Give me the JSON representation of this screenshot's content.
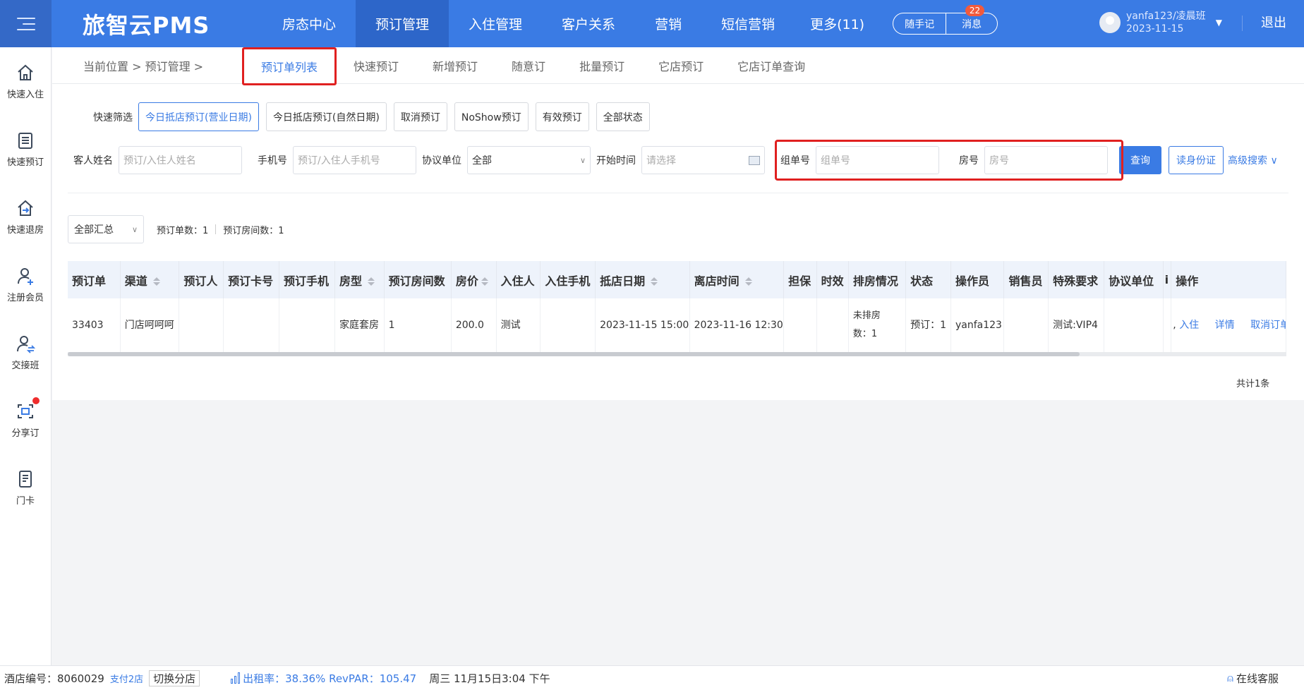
{
  "header": {
    "brand": "旅智云PMS",
    "nav": [
      "房态中心",
      "预订管理",
      "入住管理",
      "客户关系",
      "营销",
      "短信营销",
      "更多(11)"
    ],
    "active_nav": "预订管理",
    "notes_label": "随手记",
    "messages_label": "消息",
    "messages_badge": "22",
    "user_name": "yanfa123/凌晨班",
    "user_date": "2023-11-15",
    "logout": "退出"
  },
  "sidebar": [
    {
      "label": "快速入住",
      "icon": "home-icon"
    },
    {
      "label": "快速预订",
      "icon": "booking-list-icon"
    },
    {
      "label": "快速退房",
      "icon": "checkout-icon"
    },
    {
      "label": "注册会员",
      "icon": "add-member-icon"
    },
    {
      "label": "交接班",
      "icon": "shift-handover-icon"
    },
    {
      "label": "分享订",
      "icon": "share-booking-icon"
    },
    {
      "label": "门卡",
      "icon": "door-card-icon"
    }
  ],
  "breadcrumb": "当前位置 > 预订管理 >",
  "tabs": [
    "预订单列表",
    "快速预订",
    "新增预订",
    "随意订",
    "批量预订",
    "它店预订",
    "它店订单查询"
  ],
  "quick_filter": {
    "label": "快速筛选",
    "buttons": [
      "今日抵店预订(营业日期)",
      "今日抵店预订(自然日期)",
      "取消预订",
      "NoShow预订",
      "有效预订",
      "全部状态"
    ]
  },
  "search": {
    "guest_label": "客人姓名",
    "guest_placeholder": "预订/入住人姓名",
    "phone_label": "手机号",
    "phone_placeholder": "预订/入住人手机号",
    "agreement_label": "协议单位",
    "agreement_value": "全部",
    "start_label": "开始时间",
    "start_placeholder": "请选择",
    "group_label": "组单号",
    "group_placeholder": "组单号",
    "room_label": "房号",
    "room_placeholder": "房号",
    "query_btn": "查询",
    "id_btn": "读身份证",
    "advanced": "高级搜索"
  },
  "summary": {
    "select": "全部汇总",
    "orders": "预订单数：1",
    "rooms": "预订房间数：1"
  },
  "table": {
    "headers": [
      "预订单",
      "渠道",
      "预订人",
      "预订卡号",
      "预订手机",
      "房型",
      "预订房间数",
      "房价",
      "入住人",
      "入住手机",
      "抵店日期",
      "离店时间",
      "担保",
      "时效",
      "排房情况",
      "状态",
      "操作员",
      "销售员",
      "特殊要求",
      "协议单位",
      "i",
      "操作"
    ],
    "rows": [
      {
        "order": "33403",
        "channel": "门店呵呵呵",
        "booker": "",
        "card": "",
        "phone": "",
        "room_type": "家庭套房",
        "room_count": "1",
        "price": "200.0",
        "guest": "测试",
        "guest_phone": "",
        "arrival": "2023-11-15 15:00",
        "departure": "2023-11-16 12:30",
        "guarantee": "",
        "validity": "",
        "arrange_1": "未排房",
        "arrange_2": "数：1",
        "status": "预订：1",
        "operator": "yanfa123",
        "sales": "",
        "special": "测试:VIP4",
        "agreement": "",
        "ops_prefix": ",",
        "op_checkin": "入住",
        "op_detail": "详情",
        "op_cancel": "取消订单"
      }
    ],
    "total": "共计1条"
  },
  "statusbar": {
    "hotel_no": "酒店编号：8060029",
    "pay_stores": "支付2店",
    "switch_store": "切换分店",
    "occupancy": "出租率：38.36% RevPAR：105.47",
    "datetime": "周三 11月15日3:04 下午",
    "support": "在线客服"
  },
  "colors": {
    "primary": "#3a7be4",
    "highlight": "#e02020",
    "badge": "#f25a3c"
  }
}
